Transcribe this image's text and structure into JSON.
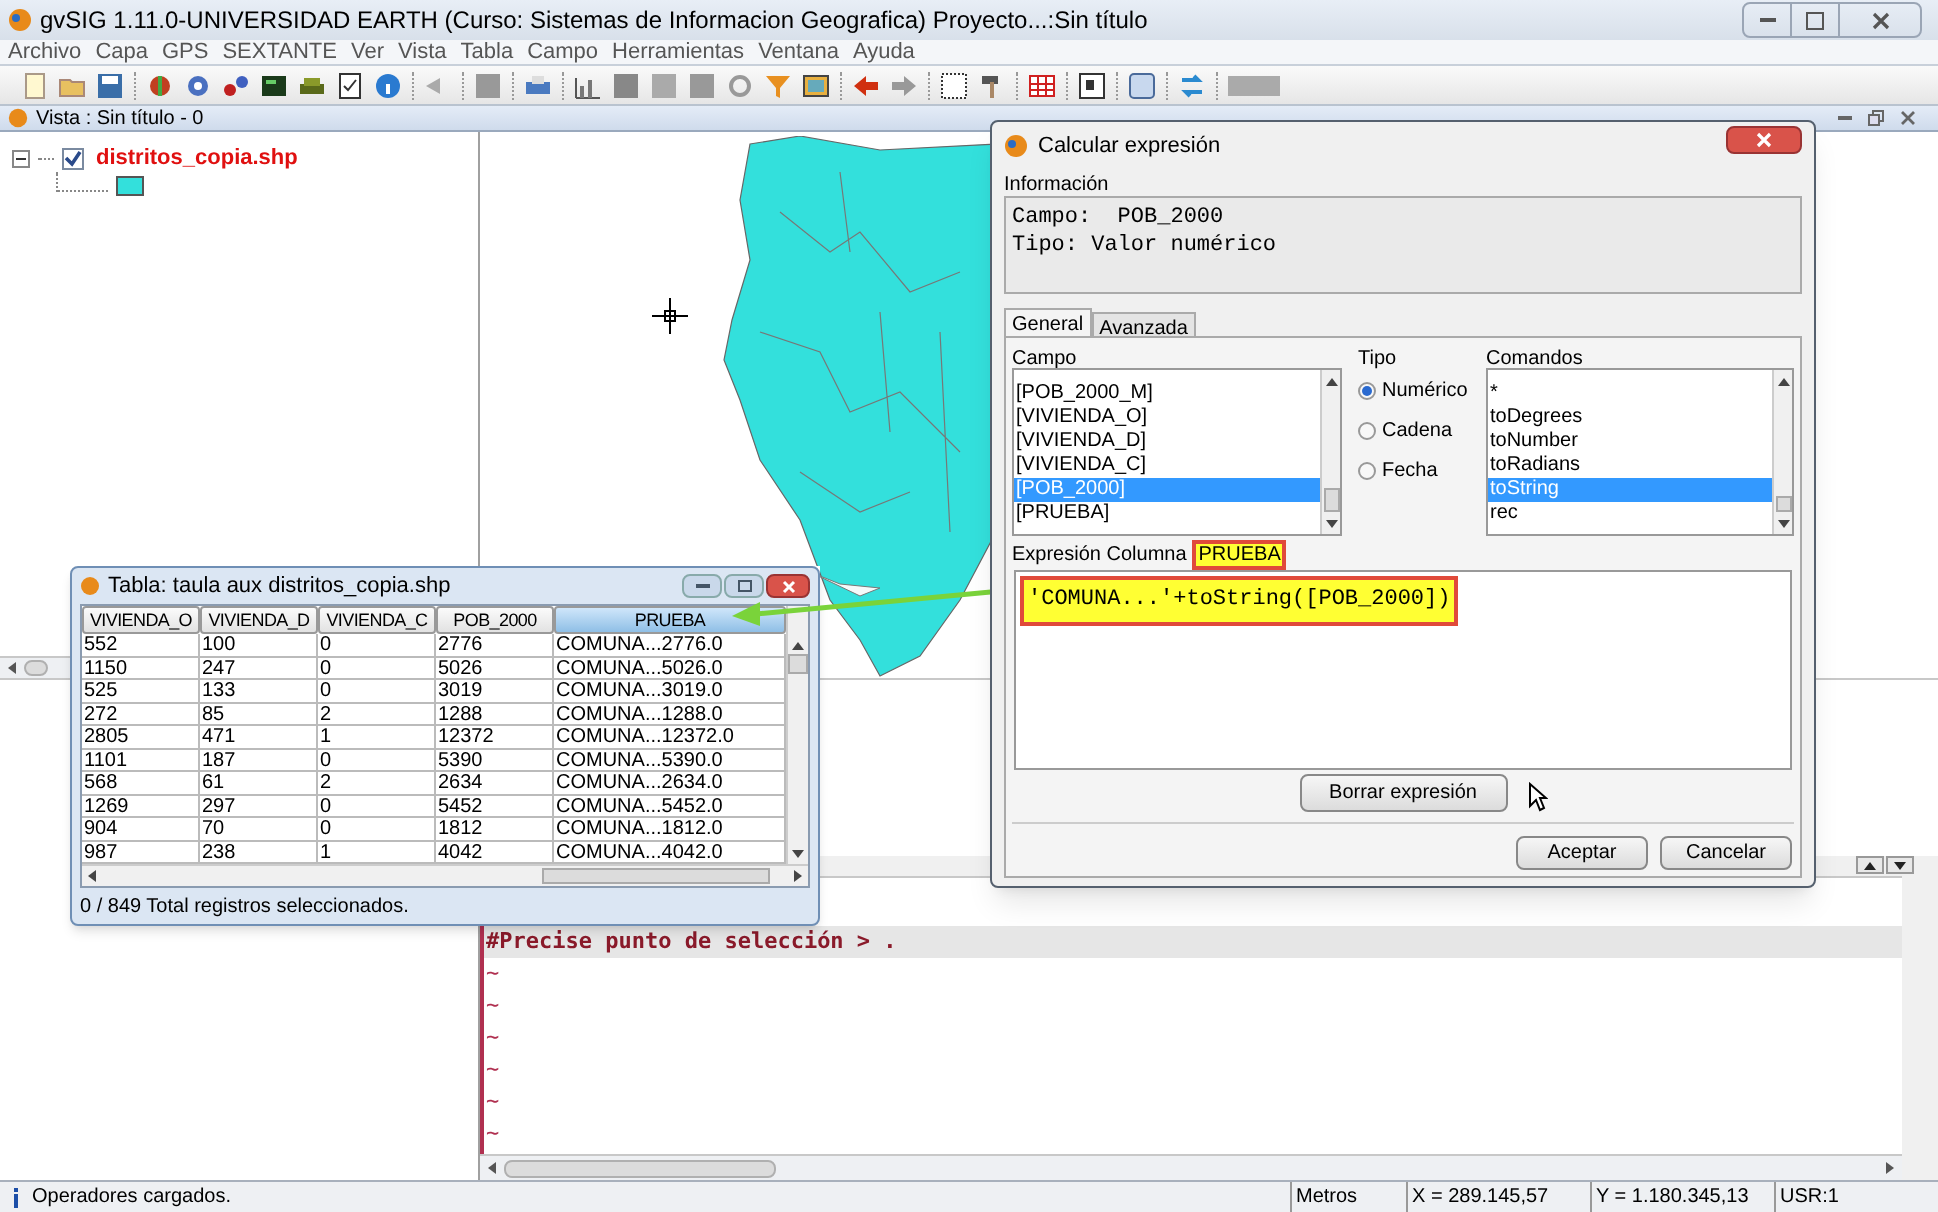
{
  "window": {
    "title": "gvSIG 1.11.0-UNIVERSIDAD EARTH (Curso: Sistemas de Informacion Geografica) Proyecto...:Sin título"
  },
  "menu": [
    "Archivo",
    "Capa",
    "GPS",
    "SEXTANTE",
    "Ver",
    "Vista",
    "Tabla",
    "Campo",
    "Herramientas",
    "Ventana",
    "Ayuda"
  ],
  "view": {
    "title": "Vista : Sin título - 0"
  },
  "layers": [
    {
      "name": "distritos_copia.shp",
      "checked": true,
      "color": "#33e0dc"
    }
  ],
  "table_window": {
    "title": "Tabla: taula aux distritos_copia.shp",
    "columns": [
      {
        "label": "VIVIENDA_O",
        "selected": false
      },
      {
        "label": "VIVIENDA_D",
        "selected": false
      },
      {
        "label": "VIVIENDA_C",
        "selected": false
      },
      {
        "label": "POB_2000",
        "selected": false
      },
      {
        "label": "PRUEBA",
        "selected": true
      }
    ],
    "rows": [
      [
        "552",
        "100",
        "0",
        "2776",
        "COMUNA...2776.0"
      ],
      [
        "1150",
        "247",
        "0",
        "5026",
        "COMUNA...5026.0"
      ],
      [
        "525",
        "133",
        "0",
        "3019",
        "COMUNA...3019.0"
      ],
      [
        "272",
        "85",
        "2",
        "1288",
        "COMUNA...1288.0"
      ],
      [
        "2805",
        "471",
        "1",
        "12372",
        "COMUNA...12372.0"
      ],
      [
        "1101",
        "187",
        "0",
        "5390",
        "COMUNA...5390.0"
      ],
      [
        "568",
        "61",
        "2",
        "2634",
        "COMUNA...2634.0"
      ],
      [
        "1269",
        "297",
        "0",
        "5452",
        "COMUNA...5452.0"
      ],
      [
        "904",
        "70",
        "0",
        "1812",
        "COMUNA...1812.0"
      ],
      [
        "987",
        "238",
        "1",
        "4042",
        "COMUNA...4042.0"
      ]
    ],
    "status": "0 / 849 Total registros seleccionados."
  },
  "dialog": {
    "title": "Calcular expresión",
    "info_label": "Información",
    "info_lines": [
      "Campo:  POB_2000",
      "Tipo: Valor numérico"
    ],
    "tabs": [
      {
        "label": "General",
        "selected": true
      },
      {
        "label": "Avanzada",
        "selected": false
      }
    ],
    "campo": {
      "label": "Campo",
      "items": [
        {
          "label": "[POB_2000_M]",
          "selected": false
        },
        {
          "label": "[VIVIENDA_O]",
          "selected": false
        },
        {
          "label": "[VIVIENDA_D]",
          "selected": false
        },
        {
          "label": "[VIVIENDA_C]",
          "selected": false
        },
        {
          "label": "[POB_2000]",
          "selected": true
        },
        {
          "label": "[PRUEBA]",
          "selected": false
        }
      ]
    },
    "tipo": {
      "label": "Tipo",
      "options": [
        {
          "label": "Numérico",
          "selected": true
        },
        {
          "label": "Cadena",
          "selected": false
        },
        {
          "label": "Fecha",
          "selected": false
        }
      ]
    },
    "comandos": {
      "label": "Comandos",
      "items": [
        {
          "label": "*",
          "selected": false
        },
        {
          "label": "toDegrees",
          "selected": false
        },
        {
          "label": "toNumber",
          "selected": false
        },
        {
          "label": "toRadians",
          "selected": false
        },
        {
          "label": "toString",
          "selected": true
        },
        {
          "label": "rec",
          "selected": false
        }
      ]
    },
    "expression_label": "Expresión Columna",
    "expression_column": "PRUEBA",
    "expression": "'COMUNA...'+toString([POB_2000])",
    "clear_button": "Borrar expresión",
    "buttons": [
      "Aceptar",
      "Cancelar"
    ]
  },
  "console": {
    "lines": [
      {
        "kind": "prompt",
        "text": "#Precise punto de selección > ."
      },
      {
        "kind": "filler",
        "text": "~"
      },
      {
        "kind": "filler",
        "text": "~"
      },
      {
        "kind": "filler",
        "text": "~"
      },
      {
        "kind": "filler",
        "text": "~"
      },
      {
        "kind": "filler",
        "text": "~"
      },
      {
        "kind": "filler",
        "text": "~"
      }
    ]
  },
  "status_bar": {
    "message": "Operadores cargados.",
    "units": "Metros",
    "x": "X = 289.145,57",
    "y": "Y = 1.180.345,13",
    "user": "USR:1"
  }
}
